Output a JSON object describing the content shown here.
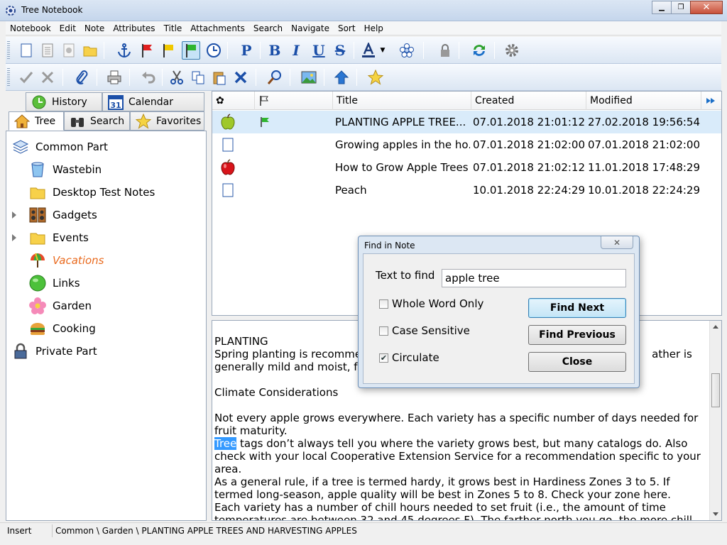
{
  "window": {
    "title": "Tree Notebook"
  },
  "menu": [
    "Notebook",
    "Edit",
    "Note",
    "Attributes",
    "Title",
    "Attachments",
    "Search",
    "Navigate",
    "Sort",
    "Help"
  ],
  "left_tabs": {
    "history": "History",
    "calendar": "Calendar",
    "calendar_day": "31",
    "tree": "Tree",
    "search": "Search",
    "favorites": "Favorites"
  },
  "tree": [
    {
      "label": "Common Part",
      "icon": "stack-icon"
    },
    {
      "label": "Wastebin",
      "icon": "bucket-icon"
    },
    {
      "label": "Desktop Test Notes",
      "icon": "folder-icon"
    },
    {
      "label": "Gadgets",
      "icon": "speaker-icon",
      "expandable": true
    },
    {
      "label": "Events",
      "icon": "folder-icon",
      "expandable": true
    },
    {
      "label": "Vacations",
      "icon": "umbrella-icon",
      "style": "italic"
    },
    {
      "label": "Links",
      "icon": "green-circle-icon"
    },
    {
      "label": "Garden",
      "icon": "flower-icon"
    },
    {
      "label": "Cooking",
      "icon": "burger-icon"
    },
    {
      "label": "Private Part",
      "icon": "lock-icon"
    }
  ],
  "list": {
    "columns": {
      "title": "Title",
      "created": "Created",
      "modified": "Modified"
    },
    "rows": [
      {
        "title": "PLANTING APPLE TREE...",
        "created": "07.01.2018 21:01:12",
        "modified": "27.02.2018 19:56:54",
        "icon": "green-apple-icon",
        "flag": true,
        "selected": true
      },
      {
        "title": "Growing apples in the ho...",
        "created": "07.01.2018 21:02:00",
        "modified": "07.01.2018 21:02:00",
        "icon": "page-icon"
      },
      {
        "title": "How to Grow Apple Trees",
        "created": "07.01.2018 21:02:12",
        "modified": "11.01.2018 17:48:29",
        "icon": "red-apple-icon"
      },
      {
        "title": "Peach",
        "created": "10.01.2018 22:24:29",
        "modified": "10.01.2018 22:24:29",
        "icon": "page-icon"
      }
    ]
  },
  "editor": {
    "heading": "PLANTING",
    "line1a": "Spring planting is recommend",
    "line1b": "ather is",
    "line2": "generally mild and moist, fall p",
    "climate": "Climate Considerations",
    "para1": "Not every apple grows everywhere. Each variety has a specific number of days needed for fruit maturity.",
    "highlight": "Tree",
    "para2": " tags don’t always tell you where the variety grows best, but many catalogs do. Also check with your local Cooperative Extension Service for a recommendation specific to your area.",
    "para3": "As a general rule, if a tree is termed hardy, it grows best in Hardiness Zones 3 to 5. If termed long-season, apple quality will be best in Zones 5 to 8. Check your zone here.",
    "para4": "Each variety has a number of chill hours needed to set fruit (i.e., the amount of time temperatures are between 32 and 45 degrees F). The farther north you go, the more chill hours an apple variety needs to avoid late spring freeze problems. Check tree tags for chill hour information or ask the seller."
  },
  "dialog": {
    "title": "Find in Note",
    "text_label": "Text to find",
    "text_value": "apple tree",
    "whole_word": "Whole Word Only",
    "case_sensitive": "Case Sensitive",
    "circulate": "Circulate",
    "find_next": "Find Next",
    "find_previous": "Find Previous",
    "close": "Close"
  },
  "status": {
    "mode": "Insert",
    "path": "Common \\ Garden \\ PLANTING APPLE TREES AND HARVESTING APPLES"
  },
  "colors": {
    "accent": "#3399ff",
    "selection": "#d9ebfa",
    "italic_node": "#e96a1e"
  }
}
